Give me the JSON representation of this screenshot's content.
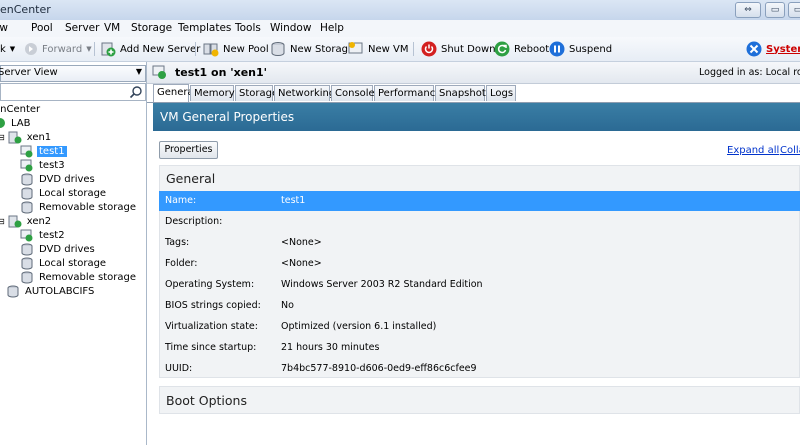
{
  "window": {
    "title": "enCenter",
    "restore_glyph": "⇔",
    "min_glyph": "▭",
    "max_glyph": "▭"
  },
  "menu": [
    "iew",
    "Pool",
    "Server",
    "VM",
    "Storage",
    "Templates",
    "Tools",
    "Window",
    "Help"
  ],
  "toolbar": {
    "back": "k",
    "forward": "Forward",
    "add_server": "Add New Server",
    "new_pool": "New Pool",
    "new_storage": "New Storage",
    "new_vm": "New VM",
    "shut_down": "Shut Down",
    "reboot": "Reboot",
    "suspend": "Suspend",
    "system_alerts": "System"
  },
  "sidebar": {
    "view": "Server View",
    "search_icon": "magnifier-icon",
    "tree": {
      "root": "enCenter",
      "pool": "LAB",
      "host1": {
        "name": "xen1",
        "items": [
          "test1",
          "test3",
          "DVD drives",
          "Local storage",
          "Removable storage"
        ]
      },
      "host2": {
        "name": "xen2",
        "items": [
          "test2",
          "DVD drives",
          "Local storage",
          "Removable storage"
        ]
      },
      "other": "AUTOLABCIFS"
    }
  },
  "header": {
    "vm_title": "test1 on 'xen1'",
    "logged_in": "Logged in as:  Local root"
  },
  "tabs": [
    "General",
    "Memory",
    "Storage",
    "Networking",
    "Console",
    "Performance",
    "Snapshots",
    "Logs"
  ],
  "active_tab": "General",
  "panel": {
    "banner": "VM General Properties",
    "properties_button": "Properties",
    "expand_all": "Expand all",
    "collapse_all": "Colla"
  },
  "general": {
    "title": "General",
    "rows": [
      {
        "k": "Name:",
        "v": "test1"
      },
      {
        "k": "Description:",
        "v": ""
      },
      {
        "k": "Tags:",
        "v": "<None>"
      },
      {
        "k": "Folder:",
        "v": "<None>"
      },
      {
        "k": "Operating System:",
        "v": "Windows Server 2003 R2 Standard Edition"
      },
      {
        "k": "BIOS strings copied:",
        "v": "No"
      },
      {
        "k": "Virtualization state:",
        "v": "Optimized (version 6.1 installed)"
      },
      {
        "k": "Time since startup:",
        "v": "21 hours 30 minutes"
      },
      {
        "k": "UUID:",
        "v": "7b4bc577-8910-d606-0ed9-eff86c6cfee9"
      }
    ]
  },
  "boot": {
    "title": "Boot Options"
  },
  "colors": {
    "selection": "#3399ff",
    "banner": "#2f719a",
    "link": "#0033cc",
    "alert": "#cc0000"
  }
}
